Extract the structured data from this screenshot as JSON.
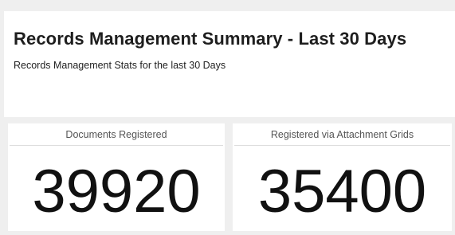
{
  "header": {
    "title": "Records Management Summary - Last 30 Days",
    "subtitle": "Records Management Stats for the last 30 Days"
  },
  "stats": [
    {
      "label": "Documents Registered",
      "value": "39920"
    },
    {
      "label": "Registered via Attachment Grids",
      "value": "35400"
    }
  ]
}
